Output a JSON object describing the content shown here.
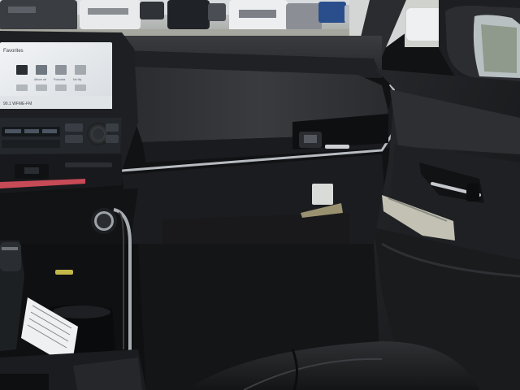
{
  "infotainment": {
    "header": "Favorites",
    "tiles": [
      "",
      "Album art",
      "Podcasts",
      "Mo·lity"
    ],
    "tiles_row2": [
      "",
      "",
      "",
      ""
    ],
    "station": "90.1 WFME-FM"
  },
  "colors": {
    "dashboard_dark": "#16181b",
    "dashboard_upper": "#2f3134",
    "silver_trim": "#b8bcc1",
    "screen_glow": "#e9ecef",
    "accent_red": "#c74a57"
  },
  "icons": [
    "climate-knob-icon",
    "start-button-icon",
    "hazard-button-icon"
  ]
}
